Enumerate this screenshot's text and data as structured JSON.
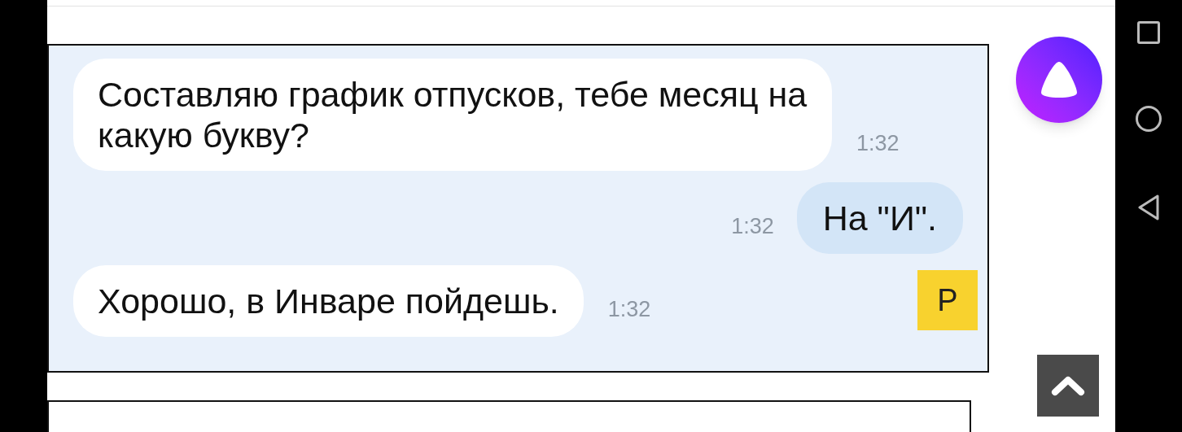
{
  "chat_image": {
    "messages": [
      {
        "kind": "incoming",
        "text": "Составляю график отпусков, тебе месяц на какую букву?",
        "time": "1:32"
      },
      {
        "kind": "outgoing",
        "text": "На \"И\".",
        "time": "1:32"
      },
      {
        "kind": "incoming",
        "text": "Хорошо, в Инваре пойдешь.",
        "time": "1:32"
      }
    ],
    "avatar": "Р"
  }
}
